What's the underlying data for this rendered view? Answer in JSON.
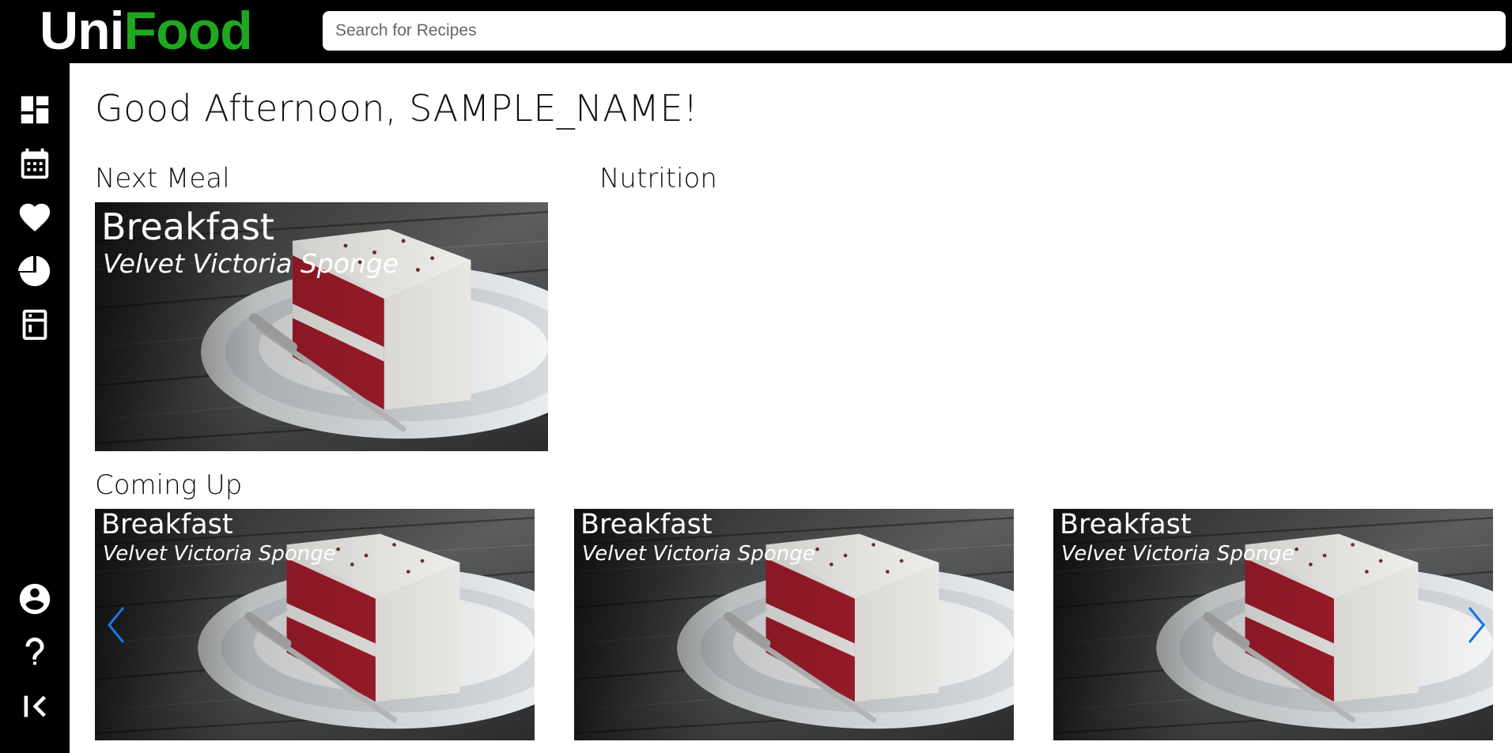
{
  "app": {
    "logo_part1": "Uni",
    "logo_part2": "Food",
    "brand_color": "#1fa81f"
  },
  "search": {
    "placeholder": "Search for Recipes",
    "value": ""
  },
  "sidebar": {
    "top_items": [
      {
        "icon": "dashboard-icon"
      },
      {
        "icon": "calendar-icon"
      },
      {
        "icon": "heart-icon"
      },
      {
        "icon": "pie-chart-icon"
      },
      {
        "icon": "fridge-icon"
      }
    ],
    "bottom_items": [
      {
        "icon": "account-icon"
      },
      {
        "icon": "help-icon"
      },
      {
        "icon": "collapse-icon"
      }
    ]
  },
  "main": {
    "greeting": "Good Afternoon, SAMPLE_NAME!",
    "next_meal": {
      "title": "Next Meal",
      "meal": "Breakfast",
      "dish": "Velvet Victoria Sponge"
    },
    "nutrition": {
      "title": "Nutrition"
    },
    "coming_up": {
      "title": "Coming Up",
      "items": [
        {
          "meal": "Breakfast",
          "dish": "Velvet Victoria Sponge"
        },
        {
          "meal": "Breakfast",
          "dish": "Velvet Victoria Sponge"
        },
        {
          "meal": "Breakfast",
          "dish": "Velvet Victoria Sponge"
        }
      ],
      "arrow_color": "#1a73e8"
    }
  }
}
